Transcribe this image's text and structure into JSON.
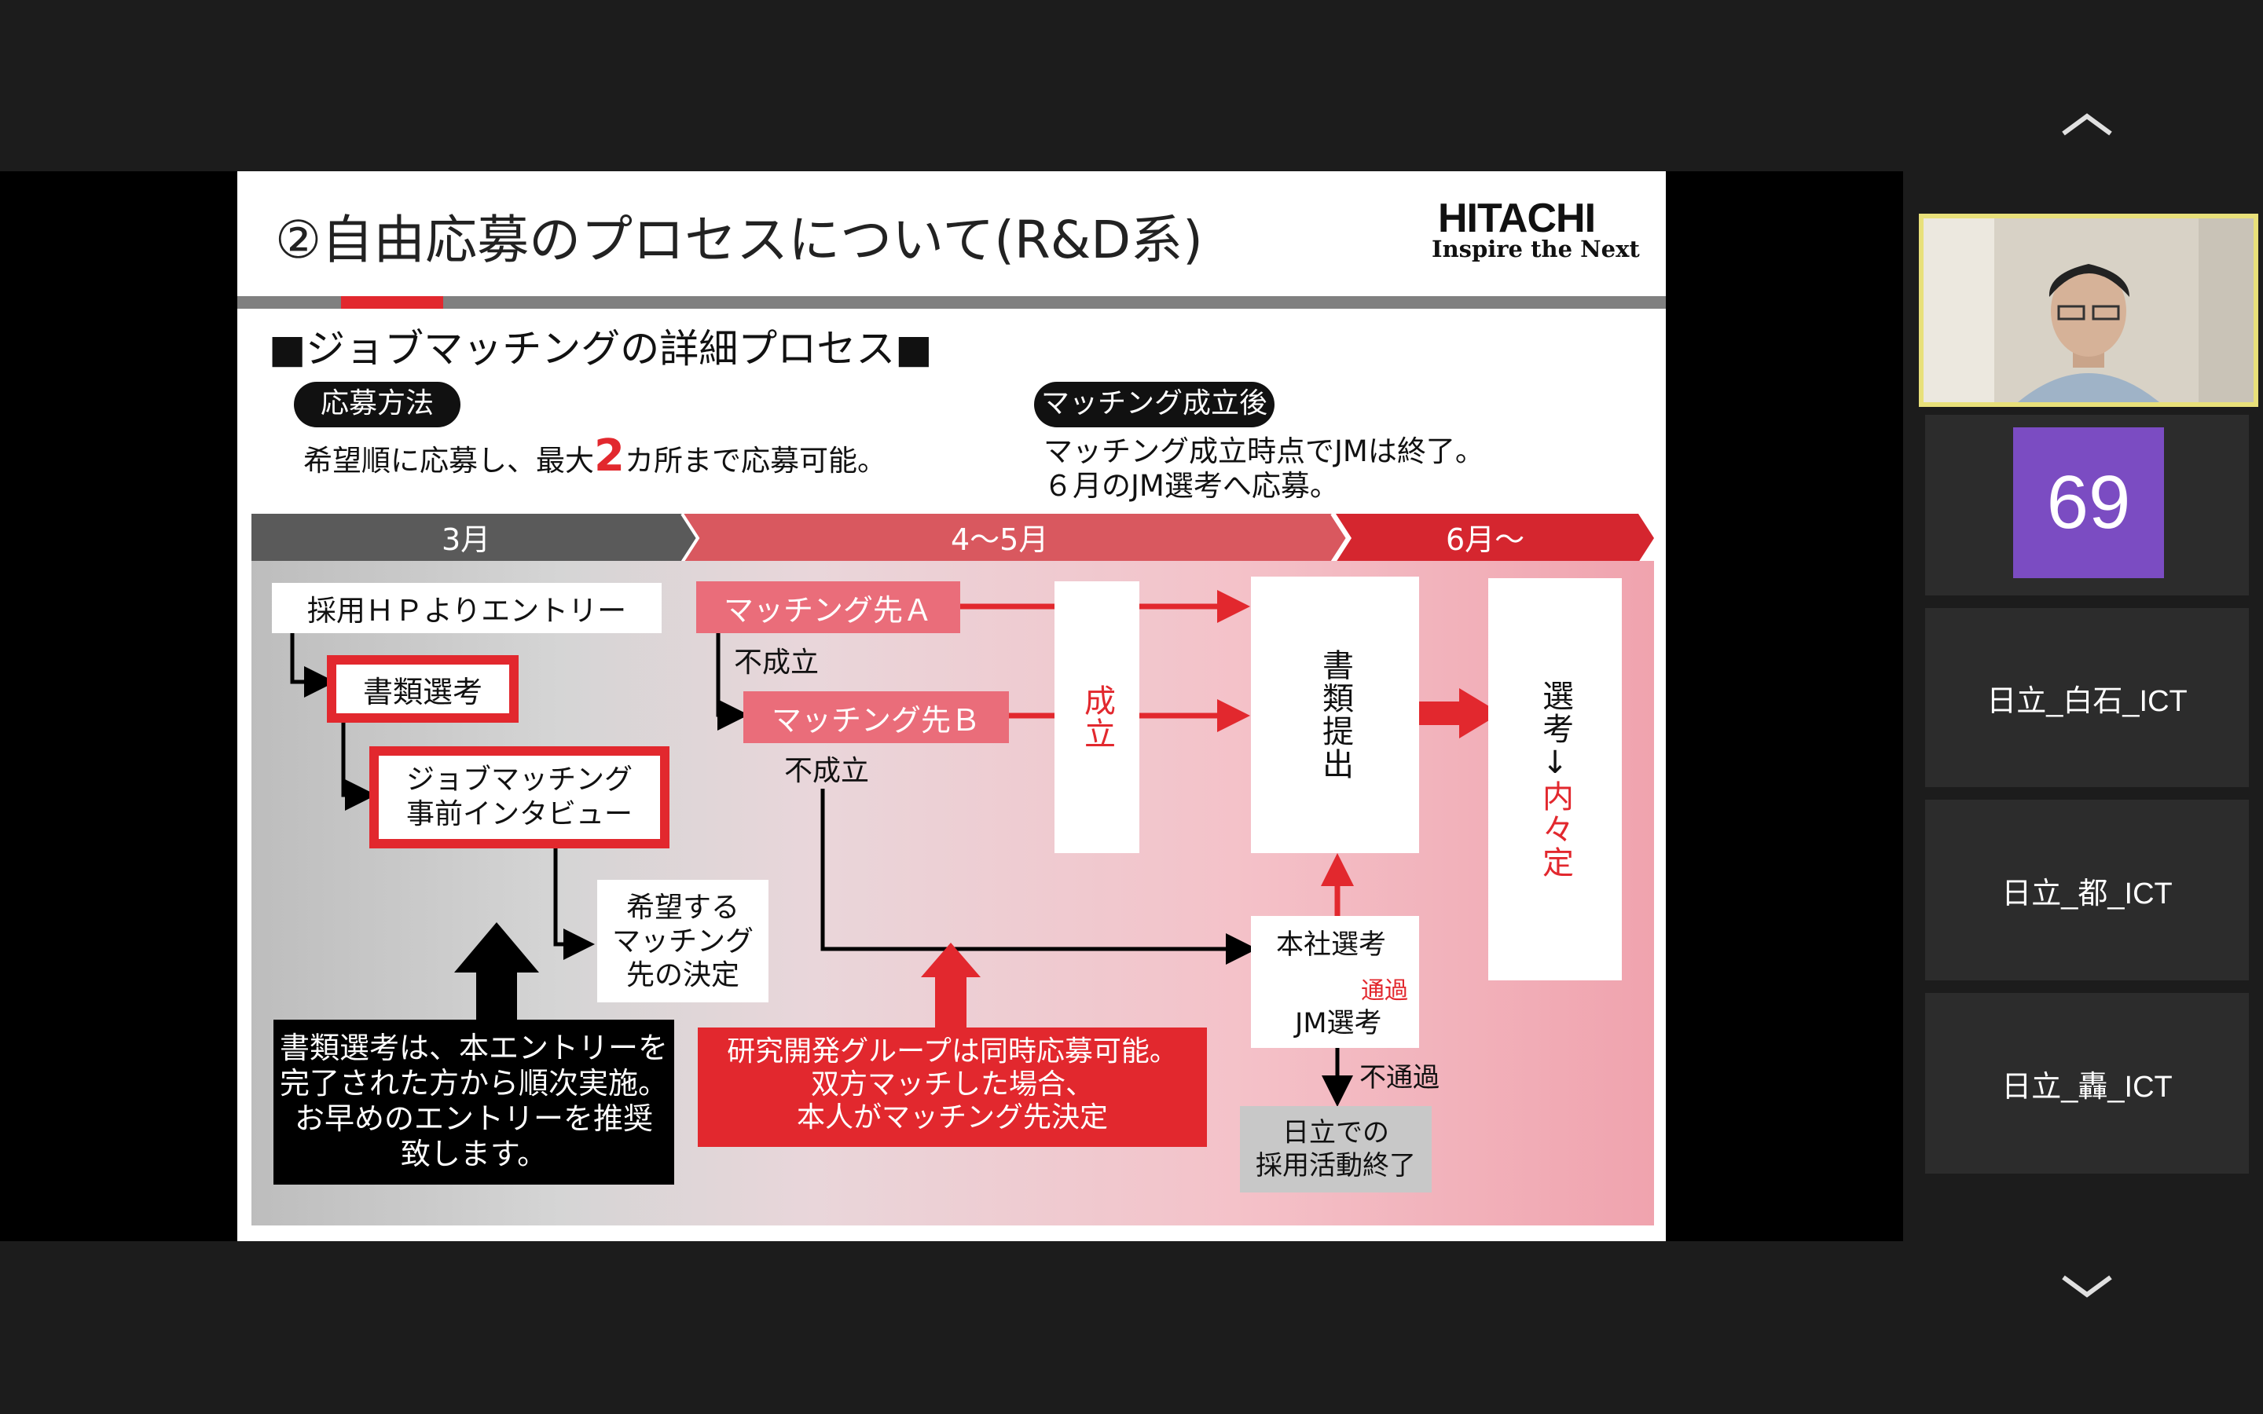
{
  "slide": {
    "title": "②自由応募のプロセスについて(R&D系)",
    "logo": {
      "name": "HITACHI",
      "tagline": "Inspire the Next"
    },
    "subtitle": "■ジョブマッチングの詳細プロセス■",
    "apply": {
      "pill": "応募方法",
      "text_a": "希望順に応募し、最大",
      "big": "2",
      "text_b": "カ所まで応募可能。"
    },
    "after": {
      "pill": "マッチング成立後",
      "line1": "マッチング成立時点でJMは終了。",
      "line2": "６月のJM選考へ応募。"
    },
    "timeline": [
      "3月",
      "4～5月",
      "6月～"
    ],
    "flow": {
      "entry": "採用ＨＰよりエントリー",
      "doc_screening": "書類選考",
      "pre_interview_1": "ジョブマッチング",
      "pre_interview_2": "事前インタビュー",
      "decide": "希望する\nマッチング\n先の決定",
      "match_a": "マッチング先Ａ",
      "match_b": "マッチング先Ｂ",
      "fail1": "不成立",
      "fail2": "不成立",
      "success": "成立",
      "submit": "書類提出",
      "select_top": "選考",
      "arrow_down": "↓",
      "select_bottom": "内々定",
      "hq": "本社選考",
      "pass": "通過",
      "jm": "JM選考",
      "not_pass": "不通過",
      "end": "日立での\n採用活動終了"
    },
    "notes": {
      "black": "書類選考は、本エントリーを\n完了された方から順次実施。\nお早めのエントリーを推奨\n致します。",
      "red": "研究開発グループは同時応募可能。\n双方マッチした場合、\n本人がマッチング先決定"
    }
  },
  "participants": {
    "count_badge": "69",
    "names": [
      "日立_白石_ICT",
      "日立_都_ICT",
      "日立_轟_ICT"
    ]
  },
  "colors": {
    "accent_red": "#e2282e",
    "pink": "#ea6d7a",
    "dark_bg": "#1c1c1c",
    "active_speaker": "#e8e07a",
    "badge": "#7b4cc2"
  }
}
